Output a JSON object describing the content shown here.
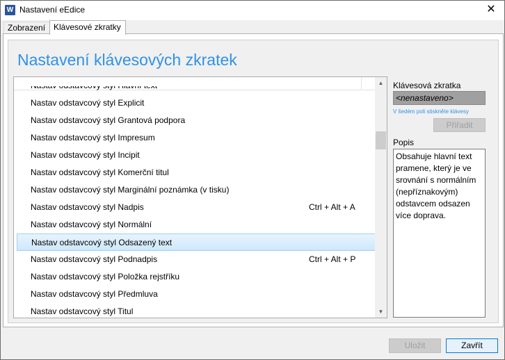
{
  "window": {
    "title": "Nastavení eEdice",
    "app_icon_letter": "W",
    "close_glyph": "✕"
  },
  "tabs": [
    {
      "label": "Zobrazení",
      "active": false
    },
    {
      "label": "Klávesové zkratky",
      "active": true
    }
  ],
  "main": {
    "heading": "Nastavení klávesových zkratek"
  },
  "list": {
    "partial_top": "Nastav odstavcový styl Hlavní text",
    "rows": [
      {
        "name": "Nastav odstavcový styl Explicit",
        "key": ""
      },
      {
        "name": "Nastav odstavcový styl Grantová podpora",
        "key": ""
      },
      {
        "name": "Nastav odstavcový styl Impresum",
        "key": ""
      },
      {
        "name": "Nastav odstavcový styl Incipit",
        "key": ""
      },
      {
        "name": "Nastav odstavcový styl Komerční titul",
        "key": ""
      },
      {
        "name": "Nastav odstavcový styl Marginální poznámka (v tisku)",
        "key": ""
      },
      {
        "name": "Nastav odstavcový styl Nadpis",
        "key": "Ctrl + Alt + A"
      },
      {
        "name": "Nastav odstavcový styl Normální",
        "key": ""
      },
      {
        "name": "Nastav odstavcový styl Odsazený text",
        "key": "",
        "selected": true
      },
      {
        "name": "Nastav odstavcový styl Podnadpis",
        "key": "Ctrl + Alt + P"
      },
      {
        "name": "Nastav odstavcový styl Položka rejstříku",
        "key": ""
      },
      {
        "name": "Nastav odstavcový styl Předmluva",
        "key": ""
      },
      {
        "name": "Nastav odstavcový styl Titul",
        "key": ""
      }
    ],
    "scroll_up_glyph": "▲",
    "scroll_down_glyph": "▼"
  },
  "shortcut": {
    "label": "Klávesová zkratka",
    "value": "<nenastaveno>",
    "hint": "V šedém poli stiskněte klávesy",
    "assign_label": "Přiřadit"
  },
  "description": {
    "label": "Popis",
    "text": "Obsahuje hlavní text pramene, který je ve srovnání s normálním (nepříznakovým) odstavcem odsazen více doprava."
  },
  "buttons": {
    "save_label": "Uložit",
    "close_label": "Zavřít"
  }
}
